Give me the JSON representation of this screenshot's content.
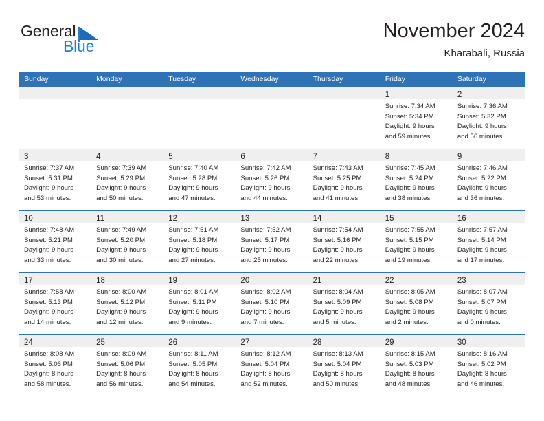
{
  "brand": {
    "name_part1": "General",
    "name_part2": "Blue",
    "mark": "triangle-flag-icon",
    "accent_color": "#1d7fd1",
    "text_color": "#231f20"
  },
  "header": {
    "title": "November 2024",
    "subtitle": "Kharabali, Russia"
  },
  "theme": {
    "header_bar_color": "#2e72b8",
    "daynum_band_color": "#efefef",
    "grid_line_color": "#2e72b8",
    "page_background": "#ffffff"
  },
  "weekday_headers": [
    "Sunday",
    "Monday",
    "Tuesday",
    "Wednesday",
    "Thursday",
    "Friday",
    "Saturday"
  ],
  "weeks": [
    [
      {
        "day": "",
        "empty": true
      },
      {
        "day": "",
        "empty": true
      },
      {
        "day": "",
        "empty": true
      },
      {
        "day": "",
        "empty": true
      },
      {
        "day": "",
        "empty": true
      },
      {
        "day": "1",
        "sunrise": "Sunrise: 7:34 AM",
        "sunset": "Sunset: 5:34 PM",
        "daylight1": "Daylight: 9 hours",
        "daylight2": "and 59 minutes."
      },
      {
        "day": "2",
        "sunrise": "Sunrise: 7:36 AM",
        "sunset": "Sunset: 5:32 PM",
        "daylight1": "Daylight: 9 hours",
        "daylight2": "and 56 minutes."
      }
    ],
    [
      {
        "day": "3",
        "sunrise": "Sunrise: 7:37 AM",
        "sunset": "Sunset: 5:31 PM",
        "daylight1": "Daylight: 9 hours",
        "daylight2": "and 53 minutes."
      },
      {
        "day": "4",
        "sunrise": "Sunrise: 7:39 AM",
        "sunset": "Sunset: 5:29 PM",
        "daylight1": "Daylight: 9 hours",
        "daylight2": "and 50 minutes."
      },
      {
        "day": "5",
        "sunrise": "Sunrise: 7:40 AM",
        "sunset": "Sunset: 5:28 PM",
        "daylight1": "Daylight: 9 hours",
        "daylight2": "and 47 minutes."
      },
      {
        "day": "6",
        "sunrise": "Sunrise: 7:42 AM",
        "sunset": "Sunset: 5:26 PM",
        "daylight1": "Daylight: 9 hours",
        "daylight2": "and 44 minutes."
      },
      {
        "day": "7",
        "sunrise": "Sunrise: 7:43 AM",
        "sunset": "Sunset: 5:25 PM",
        "daylight1": "Daylight: 9 hours",
        "daylight2": "and 41 minutes."
      },
      {
        "day": "8",
        "sunrise": "Sunrise: 7:45 AM",
        "sunset": "Sunset: 5:24 PM",
        "daylight1": "Daylight: 9 hours",
        "daylight2": "and 38 minutes."
      },
      {
        "day": "9",
        "sunrise": "Sunrise: 7:46 AM",
        "sunset": "Sunset: 5:22 PM",
        "daylight1": "Daylight: 9 hours",
        "daylight2": "and 36 minutes."
      }
    ],
    [
      {
        "day": "10",
        "sunrise": "Sunrise: 7:48 AM",
        "sunset": "Sunset: 5:21 PM",
        "daylight1": "Daylight: 9 hours",
        "daylight2": "and 33 minutes."
      },
      {
        "day": "11",
        "sunrise": "Sunrise: 7:49 AM",
        "sunset": "Sunset: 5:20 PM",
        "daylight1": "Daylight: 9 hours",
        "daylight2": "and 30 minutes."
      },
      {
        "day": "12",
        "sunrise": "Sunrise: 7:51 AM",
        "sunset": "Sunset: 5:18 PM",
        "daylight1": "Daylight: 9 hours",
        "daylight2": "and 27 minutes."
      },
      {
        "day": "13",
        "sunrise": "Sunrise: 7:52 AM",
        "sunset": "Sunset: 5:17 PM",
        "daylight1": "Daylight: 9 hours",
        "daylight2": "and 25 minutes."
      },
      {
        "day": "14",
        "sunrise": "Sunrise: 7:54 AM",
        "sunset": "Sunset: 5:16 PM",
        "daylight1": "Daylight: 9 hours",
        "daylight2": "and 22 minutes."
      },
      {
        "day": "15",
        "sunrise": "Sunrise: 7:55 AM",
        "sunset": "Sunset: 5:15 PM",
        "daylight1": "Daylight: 9 hours",
        "daylight2": "and 19 minutes."
      },
      {
        "day": "16",
        "sunrise": "Sunrise: 7:57 AM",
        "sunset": "Sunset: 5:14 PM",
        "daylight1": "Daylight: 9 hours",
        "daylight2": "and 17 minutes."
      }
    ],
    [
      {
        "day": "17",
        "sunrise": "Sunrise: 7:58 AM",
        "sunset": "Sunset: 5:13 PM",
        "daylight1": "Daylight: 9 hours",
        "daylight2": "and 14 minutes."
      },
      {
        "day": "18",
        "sunrise": "Sunrise: 8:00 AM",
        "sunset": "Sunset: 5:12 PM",
        "daylight1": "Daylight: 9 hours",
        "daylight2": "and 12 minutes."
      },
      {
        "day": "19",
        "sunrise": "Sunrise: 8:01 AM",
        "sunset": "Sunset: 5:11 PM",
        "daylight1": "Daylight: 9 hours",
        "daylight2": "and 9 minutes."
      },
      {
        "day": "20",
        "sunrise": "Sunrise: 8:02 AM",
        "sunset": "Sunset: 5:10 PM",
        "daylight1": "Daylight: 9 hours",
        "daylight2": "and 7 minutes."
      },
      {
        "day": "21",
        "sunrise": "Sunrise: 8:04 AM",
        "sunset": "Sunset: 5:09 PM",
        "daylight1": "Daylight: 9 hours",
        "daylight2": "and 5 minutes."
      },
      {
        "day": "22",
        "sunrise": "Sunrise: 8:05 AM",
        "sunset": "Sunset: 5:08 PM",
        "daylight1": "Daylight: 9 hours",
        "daylight2": "and 2 minutes."
      },
      {
        "day": "23",
        "sunrise": "Sunrise: 8:07 AM",
        "sunset": "Sunset: 5:07 PM",
        "daylight1": "Daylight: 9 hours",
        "daylight2": "and 0 minutes."
      }
    ],
    [
      {
        "day": "24",
        "sunrise": "Sunrise: 8:08 AM",
        "sunset": "Sunset: 5:06 PM",
        "daylight1": "Daylight: 8 hours",
        "daylight2": "and 58 minutes."
      },
      {
        "day": "25",
        "sunrise": "Sunrise: 8:09 AM",
        "sunset": "Sunset: 5:06 PM",
        "daylight1": "Daylight: 8 hours",
        "daylight2": "and 56 minutes."
      },
      {
        "day": "26",
        "sunrise": "Sunrise: 8:11 AM",
        "sunset": "Sunset: 5:05 PM",
        "daylight1": "Daylight: 8 hours",
        "daylight2": "and 54 minutes."
      },
      {
        "day": "27",
        "sunrise": "Sunrise: 8:12 AM",
        "sunset": "Sunset: 5:04 PM",
        "daylight1": "Daylight: 8 hours",
        "daylight2": "and 52 minutes."
      },
      {
        "day": "28",
        "sunrise": "Sunrise: 8:13 AM",
        "sunset": "Sunset: 5:04 PM",
        "daylight1": "Daylight: 8 hours",
        "daylight2": "and 50 minutes."
      },
      {
        "day": "29",
        "sunrise": "Sunrise: 8:15 AM",
        "sunset": "Sunset: 5:03 PM",
        "daylight1": "Daylight: 8 hours",
        "daylight2": "and 48 minutes."
      },
      {
        "day": "30",
        "sunrise": "Sunrise: 8:16 AM",
        "sunset": "Sunset: 5:02 PM",
        "daylight1": "Daylight: 8 hours",
        "daylight2": "and 46 minutes."
      }
    ]
  ]
}
